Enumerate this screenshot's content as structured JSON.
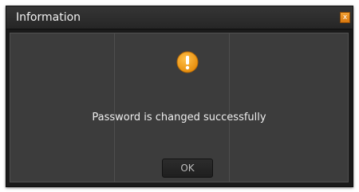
{
  "dialog": {
    "title": "Information",
    "close_label": "x",
    "icon": "warning-icon",
    "message": "Password is changed successfully",
    "ok_label": "OK"
  },
  "colors": {
    "icon_fill": "#f5a31a",
    "close_button": "#e68a1c",
    "panel": "#3c3c3c",
    "titlebar": "#2e2e2e"
  }
}
